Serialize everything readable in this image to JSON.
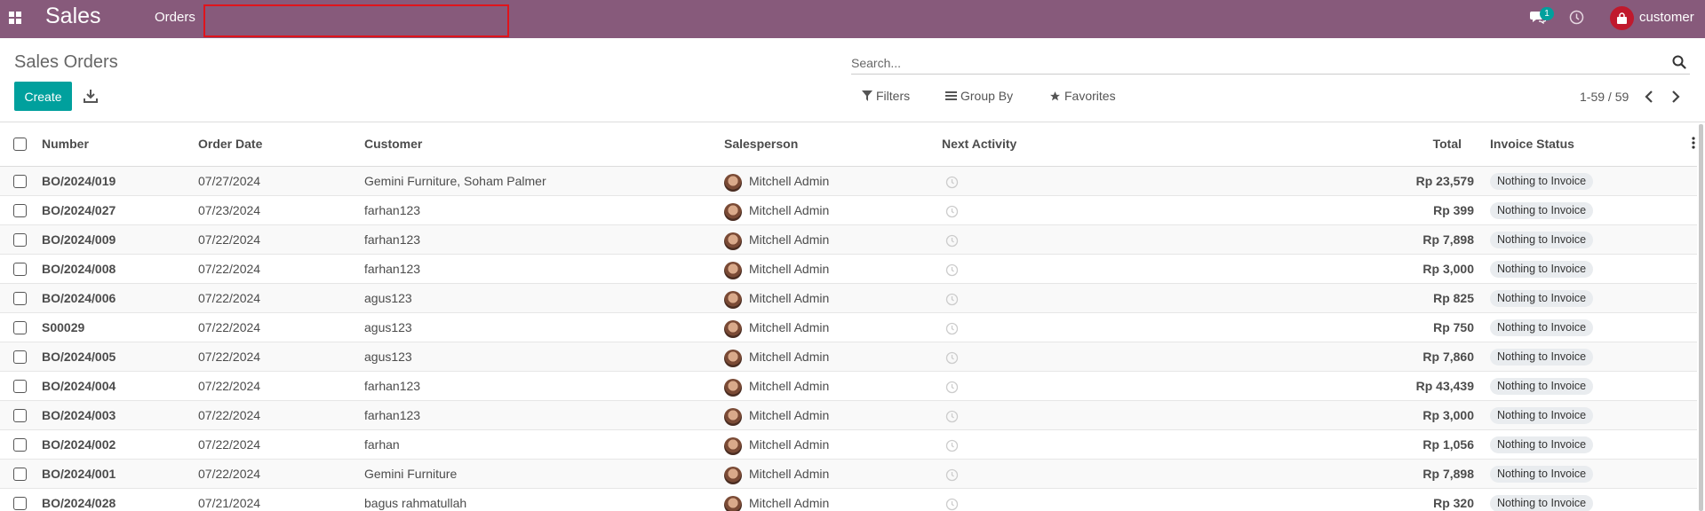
{
  "navbar": {
    "brand": "Sales",
    "menu_orders": "Orders",
    "chat_count": "1",
    "user": "customer",
    "color": "#875a7b"
  },
  "control": {
    "title": "Sales Orders",
    "search_placeholder": "Search...",
    "create_label": "Create",
    "filters_label": "Filters",
    "groupby_label": "Group By",
    "favorites_label": "Favorites",
    "pager": "1-59 / 59",
    "accent": "#00a09d"
  },
  "table": {
    "headers": {
      "number": "Number",
      "order_date": "Order Date",
      "customer": "Customer",
      "salesperson": "Salesperson",
      "next_activity": "Next Activity",
      "total": "Total",
      "invoice_status": "Invoice Status"
    },
    "rows": [
      {
        "number": "BO/2024/019",
        "date": "07/27/2024",
        "customer": "Gemini Furniture, Soham Palmer",
        "salesperson": "Mitchell Admin",
        "total": "Rp 23,579",
        "status": "Nothing to Invoice"
      },
      {
        "number": "BO/2024/027",
        "date": "07/23/2024",
        "customer": "farhan123",
        "salesperson": "Mitchell Admin",
        "total": "Rp 399",
        "status": "Nothing to Invoice"
      },
      {
        "number": "BO/2024/009",
        "date": "07/22/2024",
        "customer": "farhan123",
        "salesperson": "Mitchell Admin",
        "total": "Rp 7,898",
        "status": "Nothing to Invoice"
      },
      {
        "number": "BO/2024/008",
        "date": "07/22/2024",
        "customer": "farhan123",
        "salesperson": "Mitchell Admin",
        "total": "Rp 3,000",
        "status": "Nothing to Invoice"
      },
      {
        "number": "BO/2024/006",
        "date": "07/22/2024",
        "customer": "agus123",
        "salesperson": "Mitchell Admin",
        "total": "Rp 825",
        "status": "Nothing to Invoice"
      },
      {
        "number": "S00029",
        "date": "07/22/2024",
        "customer": "agus123",
        "salesperson": "Mitchell Admin",
        "total": "Rp 750",
        "status": "Nothing to Invoice"
      },
      {
        "number": "BO/2024/005",
        "date": "07/22/2024",
        "customer": "agus123",
        "salesperson": "Mitchell Admin",
        "total": "Rp 7,860",
        "status": "Nothing to Invoice"
      },
      {
        "number": "BO/2024/004",
        "date": "07/22/2024",
        "customer": "farhan123",
        "salesperson": "Mitchell Admin",
        "total": "Rp 43,439",
        "status": "Nothing to Invoice"
      },
      {
        "number": "BO/2024/003",
        "date": "07/22/2024",
        "customer": "farhan123",
        "salesperson": "Mitchell Admin",
        "total": "Rp 3,000",
        "status": "Nothing to Invoice"
      },
      {
        "number": "BO/2024/002",
        "date": "07/22/2024",
        "customer": "farhan",
        "salesperson": "Mitchell Admin",
        "total": "Rp 1,056",
        "status": "Nothing to Invoice"
      },
      {
        "number": "BO/2024/001",
        "date": "07/22/2024",
        "customer": "Gemini Furniture",
        "salesperson": "Mitchell Admin",
        "total": "Rp 7,898",
        "status": "Nothing to Invoice"
      },
      {
        "number": "BO/2024/028",
        "date": "07/21/2024",
        "customer": "bagus rahmatullah",
        "salesperson": "Mitchell Admin",
        "total": "Rp 320",
        "status": "Nothing to Invoice"
      }
    ]
  }
}
